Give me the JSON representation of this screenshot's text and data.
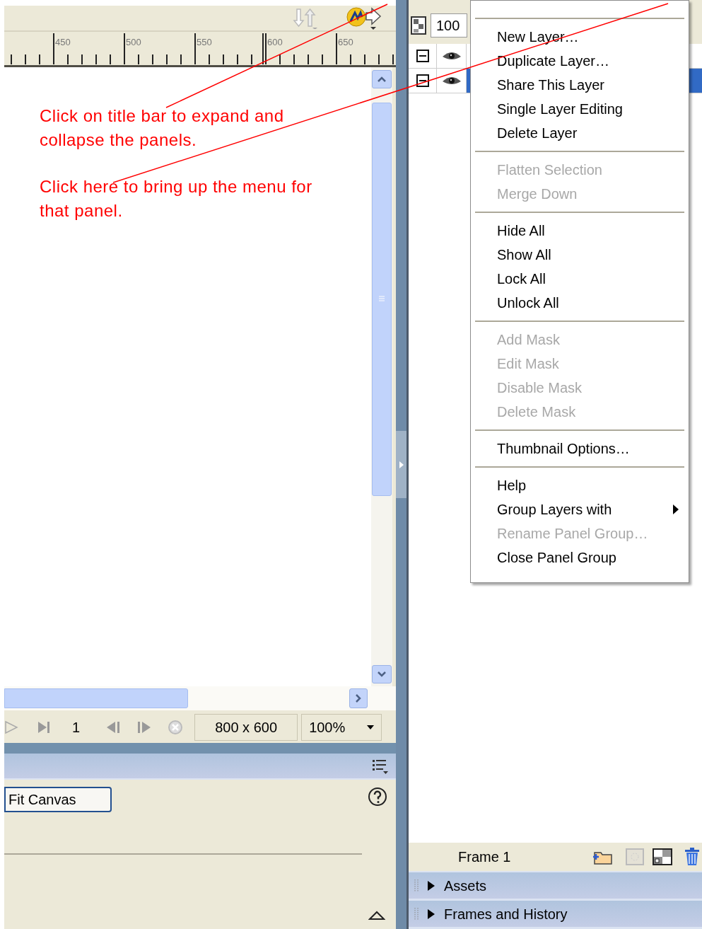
{
  "ruler": {
    "labels": [
      "450",
      "500",
      "550",
      "600",
      "650"
    ]
  },
  "annotations": [
    {
      "text": "Click on title bar to expand and collapse the panels."
    },
    {
      "text": "Click here to bring up the menu for that panel."
    }
  ],
  "status_bar": {
    "frame": "1",
    "canvas_size": "800 x 600",
    "zoom": "100%"
  },
  "properties_panel": {
    "button": "Fit Canvas"
  },
  "layers_panel": {
    "opacity": "100",
    "rows": [
      {
        "selected": false
      },
      {
        "selected": true
      }
    ],
    "frame_label": "Frame 1"
  },
  "context_menu": {
    "groups": [
      [
        {
          "label": "New Layer…",
          "disabled": false,
          "submenu": false
        },
        {
          "label": "Duplicate Layer…",
          "disabled": false,
          "submenu": false
        },
        {
          "label": "Share This Layer",
          "disabled": false,
          "submenu": false
        },
        {
          "label": "Single Layer Editing",
          "disabled": false,
          "submenu": false
        },
        {
          "label": "Delete Layer",
          "disabled": false,
          "submenu": false
        }
      ],
      [
        {
          "label": "Flatten Selection",
          "disabled": true,
          "submenu": false
        },
        {
          "label": "Merge Down",
          "disabled": true,
          "submenu": false
        }
      ],
      [
        {
          "label": "Hide All",
          "disabled": false,
          "submenu": false
        },
        {
          "label": "Show All",
          "disabled": false,
          "submenu": false
        },
        {
          "label": "Lock All",
          "disabled": false,
          "submenu": false
        },
        {
          "label": "Unlock All",
          "disabled": false,
          "submenu": false
        }
      ],
      [
        {
          "label": "Add Mask",
          "disabled": true,
          "submenu": false
        },
        {
          "label": "Edit Mask",
          "disabled": true,
          "submenu": false
        },
        {
          "label": "Disable Mask",
          "disabled": true,
          "submenu": false
        },
        {
          "label": "Delete Mask",
          "disabled": true,
          "submenu": false
        }
      ],
      [
        {
          "label": "Thumbnail Options…",
          "disabled": false,
          "submenu": false
        }
      ],
      [
        {
          "label": "Help",
          "disabled": false,
          "submenu": false
        },
        {
          "label": "Group Layers with",
          "disabled": false,
          "submenu": true
        },
        {
          "label": "Rename Panel Group…",
          "disabled": true,
          "submenu": false
        },
        {
          "label": "Close Panel Group",
          "disabled": false,
          "submenu": false
        }
      ]
    ]
  },
  "collapsed_panels": [
    {
      "title": "Assets",
      "expanded": false
    },
    {
      "title": "Frames and History",
      "expanded": false
    }
  ]
}
